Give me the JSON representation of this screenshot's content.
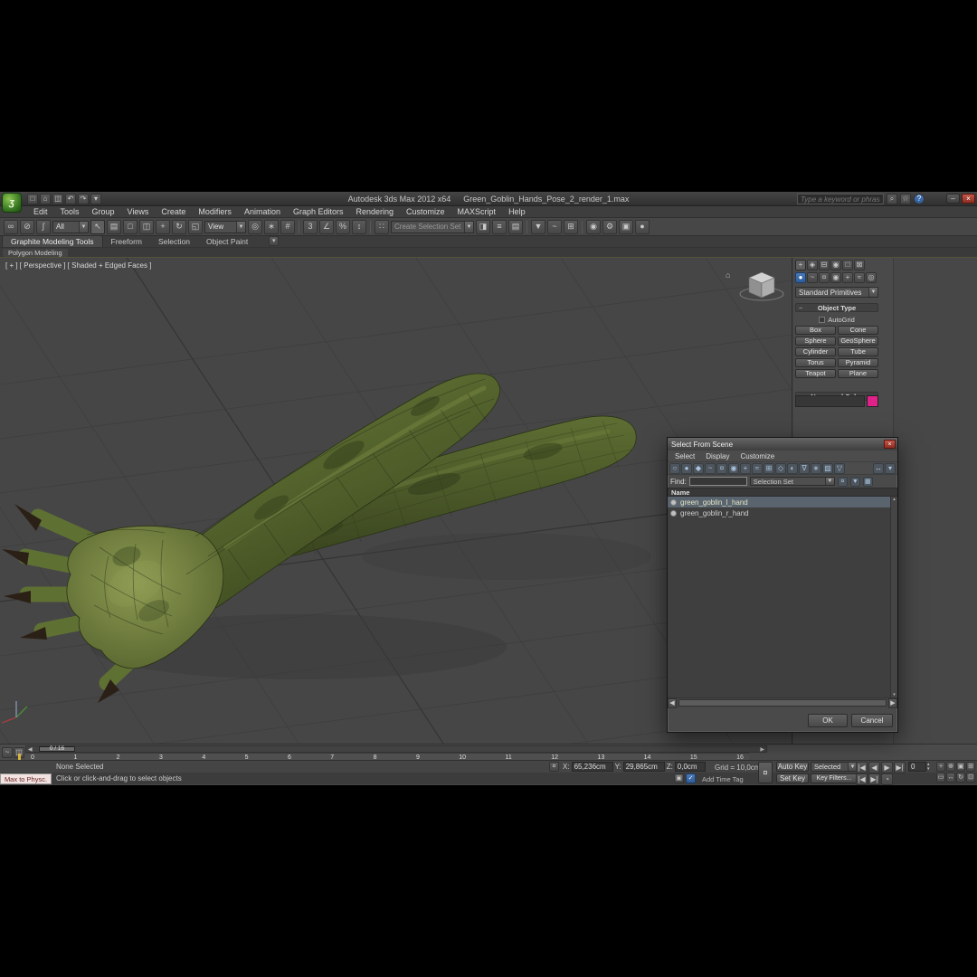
{
  "titlebar": {
    "app_title": "Autodesk 3ds Max 2012 x64",
    "file_name": "Green_Goblin_Hands_Pose_2_render_1.max",
    "search_placeholder": "Type a keyword or phrase"
  },
  "menus": [
    "Edit",
    "Tools",
    "Group",
    "Views",
    "Create",
    "Modifiers",
    "Animation",
    "Graph Editors",
    "Rendering",
    "Customize",
    "MAXScript",
    "Help"
  ],
  "toolbar": {
    "filter_dropdown": "All",
    "ref_coord_dropdown": "View",
    "selection_set_placeholder": "Create Selection Set"
  },
  "ribbon": {
    "tabs": [
      "Graphite Modeling Tools",
      "Freeform",
      "Selection",
      "Object Paint"
    ],
    "panel_label": "Polygon Modeling"
  },
  "viewport": {
    "label": "[ + ] [ Perspective ] [ Shaded + Edged Faces ]"
  },
  "command_panel": {
    "primitives_dropdown": "Standard Primitives",
    "object_type_rollout": "Object Type",
    "autogrid_label": "AutoGrid",
    "buttons": [
      "Box",
      "Cone",
      "Sphere",
      "GeoSphere",
      "Cylinder",
      "Tube",
      "Torus",
      "Pyramid",
      "Teapot",
      "Plane"
    ],
    "name_color_rollout": "Name and Color"
  },
  "dialog": {
    "title": "Select From Scene",
    "menus": [
      "Select",
      "Display",
      "Customize"
    ],
    "find_label": "Find:",
    "selection_set_label": "Selection Set",
    "name_header": "Name",
    "rows": [
      "green_goblin_l_hand",
      "green_goblin_r_hand"
    ],
    "ok_label": "OK",
    "cancel_label": "Cancel"
  },
  "timeline": {
    "slider_label": "0 / 16",
    "ticks": [
      "0",
      "1",
      "2",
      "3",
      "4",
      "5",
      "6",
      "7",
      "8",
      "9",
      "10",
      "11",
      "12",
      "13",
      "14",
      "15",
      "16"
    ]
  },
  "status": {
    "selection": "None Selected",
    "prompt": "Click or click-and-drag to select objects",
    "listener_text": "Max to Physc.",
    "x_label": "X:",
    "x_value": "65,236cm",
    "y_label": "Y:",
    "y_value": "29,865cm",
    "z_label": "Z:",
    "z_value": "0,0cm",
    "grid_label": "Grid = 10,0cm",
    "add_time_tag": "Add Time Tag",
    "auto_key": "Auto Key",
    "set_key": "Set Key",
    "selected_dropdown": "Selected",
    "key_filters": "Key Filters...",
    "frame_value": "0"
  },
  "colors": {
    "accent_blue": "#2e5d99",
    "object_color_swatch": "#e0218a",
    "viewport_bg": "#464646"
  },
  "icons": {
    "new": "□",
    "open": "⌂",
    "save": "◫",
    "undo": "↶",
    "redo": "↷",
    "dropdown": "▾",
    "search": "⌕",
    "star": "☆",
    "help": "?",
    "min": "–",
    "max": "□",
    "close": "×",
    "link": "∞",
    "unlink": "⊘",
    "bind": "∫",
    "select": "↖",
    "select-name": "▤",
    "region": "□",
    "crossing": "◫",
    "move": "+",
    "rotate": "↻",
    "scale": "◱",
    "pivot": "◎",
    "manipulate": "∗",
    "kbd": "#",
    "snap3": "3",
    "snapang": "∠",
    "snappct": "%",
    "snapspin": "↕",
    "namedsel": "∷",
    "mirror": "◨",
    "align": "≡",
    "layers": "▤",
    "graphite": "▼",
    "curve": "~",
    "schematic": "⊞",
    "material": "◉",
    "rsetup": "⚙",
    "rframe": "▣",
    "render": "●",
    "tab-create": "+",
    "tab-modify": "◈",
    "tab-hier": "⊟",
    "tab-motion": "◉",
    "tab-display": "□",
    "tab-util": "⊠",
    "cat-geom": "●",
    "cat-shapes": "~",
    "cat-lights": "¤",
    "cat-cams": "◉",
    "cat-help": "+",
    "cat-warp": "≈",
    "cat-sys": "◎",
    "roll-minus": "−",
    "lock": "¤",
    "key": "¤",
    "gostart": "|◀",
    "prevf": "◀",
    "play": "▶",
    "goend": "▶|",
    "prevk": "|◀",
    "nextk": "▶|",
    "spinup": "▴",
    "spindn": "▾",
    "timecfg": "◔",
    "zoom": "+",
    "zoomall": "⊕",
    "zoomext": "▣",
    "zoomexta": "⊞",
    "zoomrgn": "▭",
    "pan": "↔",
    "orbit": "↻",
    "maxvp": "⊡",
    "minicurve": "~",
    "trackcfg": "◫",
    "isolate": "▣",
    "sellock": "✓",
    "sl": "◀",
    "sr": "▶",
    "su": "▴",
    "sd": "▾",
    "display-none": "○",
    "display-all": "●",
    "display-geometry": "◆",
    "display-shapes": "~",
    "display-lights": "¤",
    "display-cameras": "◉",
    "display-helpers": "+",
    "display-spacewarps": "≈",
    "display-groups": "⊞",
    "display-xrefs": "◇",
    "display-materials": "◐",
    "display-bones": "∇",
    "display-frozen": "∗",
    "display-hidden": "▨",
    "expand-tree": "▽",
    "sync-selection": "↔",
    "flock": "¤",
    "ffilter": "▼",
    "fcols": "▦",
    "fcfg": "▾"
  }
}
